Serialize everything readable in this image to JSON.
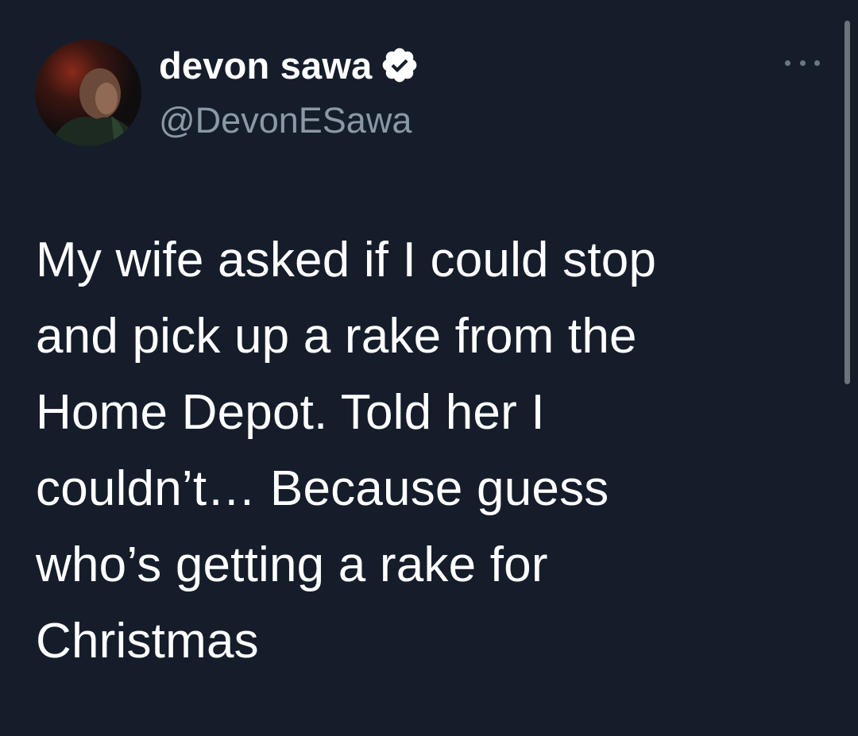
{
  "author": {
    "display_name": "devon sawa",
    "handle": "@DevonESawa",
    "verified": true,
    "verified_icon": "verified-badge-icon",
    "avatar_icon": "profile-photo-avatar"
  },
  "menu": {
    "icon": "more-options-icon"
  },
  "tweet": {
    "text": "My wife asked if I could stop\nand pick up a rake from the\nHome Depot. Told her I\ncouldn’t… Because guess\nwho’s getting a rake for\nChristmas"
  },
  "colors": {
    "background": "#151d2b",
    "text_primary": "#ffffff",
    "text_secondary": "#8b98a5"
  }
}
